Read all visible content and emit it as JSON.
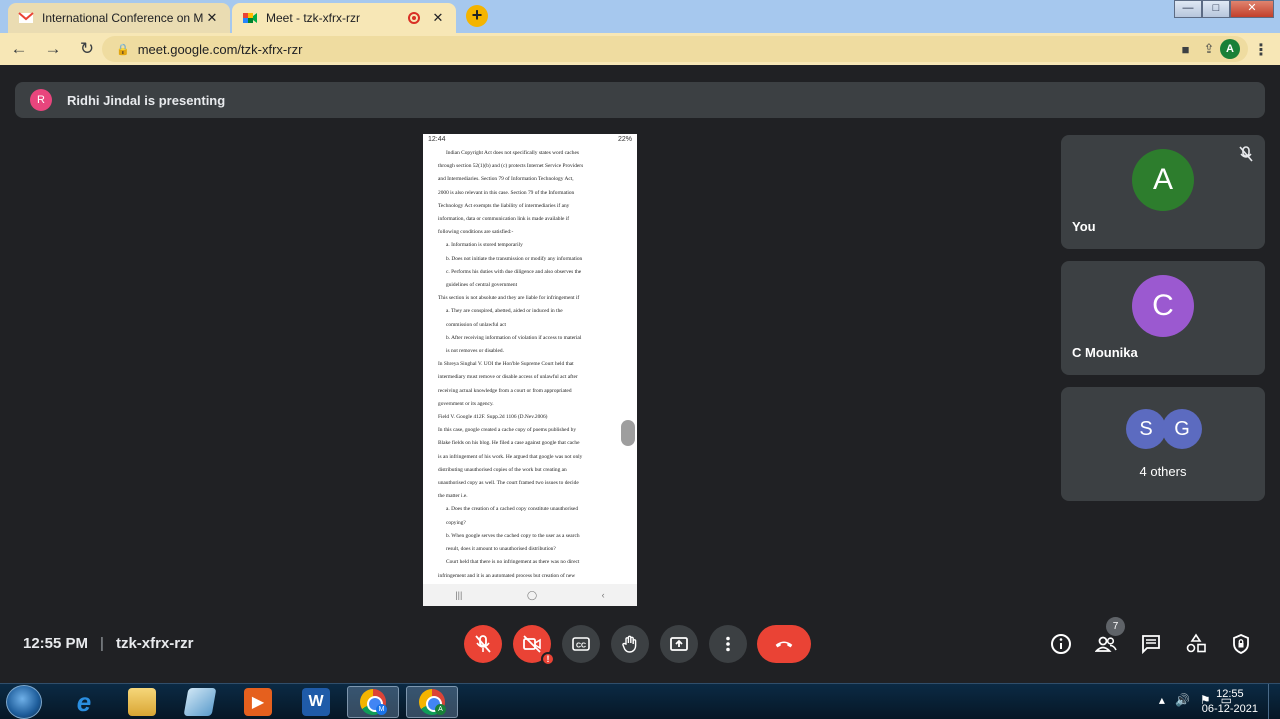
{
  "browser": {
    "tabs": [
      {
        "title": "International Conference on Mult",
        "close": "✕"
      },
      {
        "title": "Meet - tzk-xfrx-rzr",
        "close": "✕"
      }
    ],
    "new_tab": "+",
    "url": "meet.google.com/tzk-xfrx-rzr",
    "profile_initial": "A",
    "window_controls": {
      "minimize": "—",
      "maximize": "□",
      "close": "✕"
    }
  },
  "meet": {
    "presenter_initial": "R",
    "presenting_text": "Ridhi Jindal is presenting",
    "participants": [
      {
        "initial": "A",
        "name": "You",
        "color": "#2d7d2d"
      },
      {
        "initial": "C",
        "name": "C Mounika",
        "color": "#9b59d0"
      }
    ],
    "others": {
      "initials": [
        "S",
        "G"
      ],
      "label": "4 others",
      "color": "#5c6bc0"
    },
    "time": "12:55 PM",
    "separator": "|",
    "meeting_code": "tzk-xfrx-rzr",
    "participant_count": "7",
    "camera_error": "!"
  },
  "shared_screen": {
    "status_time": "12:44",
    "status_right": "22%",
    "lines": [
      {
        "cls": "ind",
        "text": "Indian Copyright Act does not specifically states word caches"
      },
      {
        "cls": "",
        "text": "through section 52(1)(b) and (c) protects Internet Service Providers"
      },
      {
        "cls": "",
        "text": "and Intermediaries. Section 79 of Information Technology Act,"
      },
      {
        "cls": "",
        "text": "2000 is also relevant in this case. Section 79 of the Information"
      },
      {
        "cls": "",
        "text": "Technology Act exempts the liability of intermediaries if any"
      },
      {
        "cls": "",
        "text": "information, data or communication link is made available if"
      },
      {
        "cls": "",
        "text": "following conditions are satisfied:-"
      },
      {
        "cls": "li",
        "text": "a. Information is stored temporarily"
      },
      {
        "cls": "li",
        "text": "b. Does not initiate the transmission or modify any information"
      },
      {
        "cls": "li",
        "text": "c. Performs his duties with due diligence and also observes the"
      },
      {
        "cls": "li",
        "text": "    guidelines of central government"
      },
      {
        "cls": "",
        "text": "This section is not absolute and they are liable for infringement if"
      },
      {
        "cls": "li",
        "text": "a. They are conspired, abetted, aided or induced in the"
      },
      {
        "cls": "li",
        "text": "    commission of unlawful act"
      },
      {
        "cls": "li",
        "text": "b. After receiving information of violation if access to material"
      },
      {
        "cls": "li",
        "text": "    is not removes or disabled."
      },
      {
        "cls": "",
        "text": "In Shreya Singhal V. UOI the Hon'ble Supreme Court held that"
      },
      {
        "cls": "",
        "text": "intermediary must remove or disable access of unlawful act after"
      },
      {
        "cls": "",
        "text": "receiving actual knowledge from a court or from appropriated"
      },
      {
        "cls": "",
        "text": "government or its agency."
      },
      {
        "cls": "",
        "text": "Field V. Google 412F. Supp.2d 1106 (D.Nev.2006)"
      },
      {
        "cls": "",
        "text": "In this case, google created a cache copy of poems published by"
      },
      {
        "cls": "",
        "text": "Blake fields on his blog. He filed a case against google that cache"
      },
      {
        "cls": "",
        "text": "is an infringement of his work. He argued that google was not only"
      },
      {
        "cls": "",
        "text": "distributing unauthorised copies of the work but creating an"
      },
      {
        "cls": "",
        "text": "unauthorised copy as well. The court framed two issues to decide"
      },
      {
        "cls": "",
        "text": "the matter i.e."
      },
      {
        "cls": "li",
        "text": "a. Does the creation of a cached copy constitute unauthorised"
      },
      {
        "cls": "li",
        "text": "    copying?"
      },
      {
        "cls": "li",
        "text": "b. When google serves the cached copy to the user as a search"
      },
      {
        "cls": "li",
        "text": "    result, does it amount to unauthorised distribution?"
      },
      {
        "cls": "ind",
        "text": "Court held that there is no infringement as there was no direct"
      },
      {
        "cls": "",
        "text": "infringement and it is an automated process but creation of new"
      }
    ]
  },
  "taskbar": {
    "time": "12:55",
    "date": "06-12-2021",
    "chrome_badges": [
      "M",
      "A"
    ]
  }
}
